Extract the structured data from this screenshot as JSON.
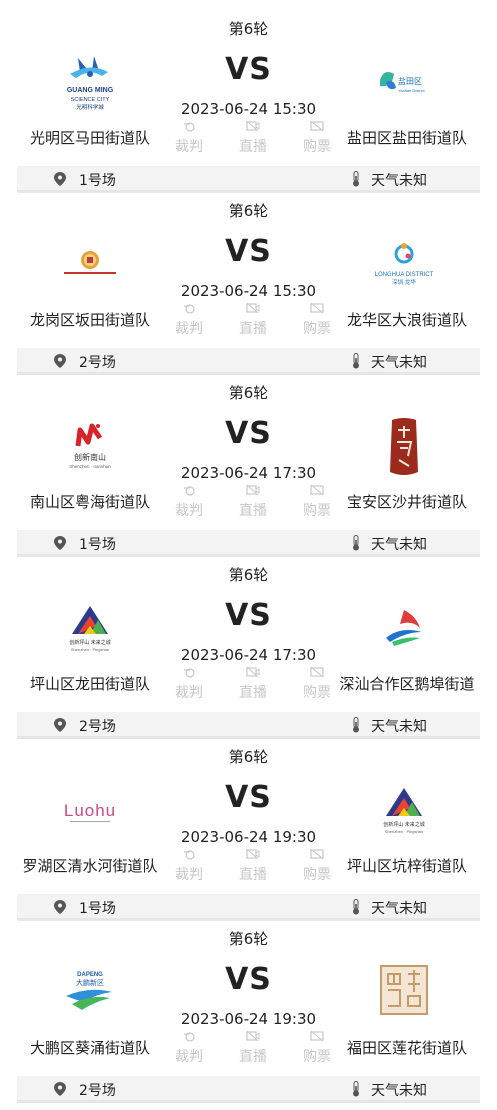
{
  "matches": [
    {
      "round": "第6轮",
      "vs": "VS",
      "time": "2023-06-24 15:30",
      "home": "光明区马田街道队",
      "away": "盐田区盐田街道队",
      "home_logo": {
        "text": "GUANG MING",
        "sub": "SCIENCE CITY",
        "sub2": "光明科学城"
      },
      "away_logo": {
        "text": "盐田区",
        "sub": "Yantian District"
      },
      "referee": "裁判",
      "live": "直播",
      "ticket": "购票",
      "venue": "1号场",
      "weather": "天气未知"
    },
    {
      "round": "第6轮",
      "vs": "VS",
      "time": "2023-06-24 15:30",
      "home": "龙岗区坂田街道队",
      "away": "龙华区大浪街道队",
      "home_logo": {
        "text": "",
        "sub": "",
        "sub2": ""
      },
      "away_logo": {
        "text": "LONGHUA DISTRICT",
        "sub": "深圳·龙华"
      },
      "referee": "裁判",
      "live": "直播",
      "ticket": "购票",
      "venue": "2号场",
      "weather": "天气未知"
    },
    {
      "round": "第6轮",
      "vs": "VS",
      "time": "2023-06-24 17:30",
      "home": "南山区粤海街道队",
      "away": "宝安区沙井街道队",
      "home_logo": {
        "text": "创新南山",
        "sub": "Shenzhen · nanshan",
        "sub2": ""
      },
      "away_logo": {
        "text": "",
        "sub": ""
      },
      "referee": "裁判",
      "live": "直播",
      "ticket": "购票",
      "venue": "1号场",
      "weather": "天气未知"
    },
    {
      "round": "第6轮",
      "vs": "VS",
      "time": "2023-06-24 17:30",
      "home": "坪山区龙田街道队",
      "away": "深汕合作区鹅埠街道",
      "home_logo": {
        "text": "创新坪山 未来之城",
        "sub": "Shenzhen · Pingshan",
        "sub2": ""
      },
      "away_logo": {
        "text": "",
        "sub": ""
      },
      "referee": "裁判",
      "live": "直播",
      "ticket": "购票",
      "venue": "2号场",
      "weather": "天气未知"
    },
    {
      "round": "第6轮",
      "vs": "VS",
      "time": "2023-06-24 19:30",
      "home": "罗湖区清水河街道队",
      "away": "坪山区坑梓街道队",
      "home_logo": {
        "text": "Luohu",
        "sub": "",
        "sub2": ""
      },
      "away_logo": {
        "text": "创新坪山 未来之城",
        "sub": "Shenzhen · Pingshan"
      },
      "referee": "裁判",
      "live": "直播",
      "ticket": "购票",
      "venue": "1号场",
      "weather": "天气未知"
    },
    {
      "round": "第6轮",
      "vs": "VS",
      "time": "2023-06-24 19:30",
      "home": "大鹏区葵涌街道队",
      "away": "福田区莲花街道队",
      "home_logo": {
        "text": "DAPENG",
        "sub": "大鹏新区",
        "sub2": ""
      },
      "away_logo": {
        "text": "",
        "sub": ""
      },
      "referee": "裁判",
      "live": "直播",
      "ticket": "购票",
      "venue": "2号场",
      "weather": "天气未知"
    }
  ]
}
